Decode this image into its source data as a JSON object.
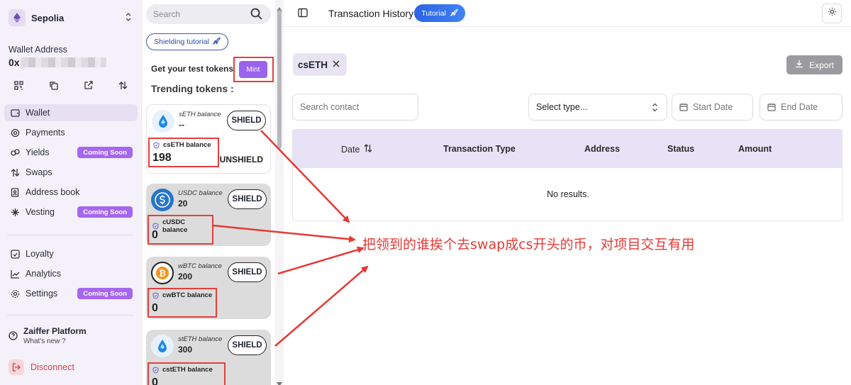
{
  "sidebar": {
    "network": "Sepolia",
    "wallet_label": "Wallet Address",
    "wallet_prefix": "0x",
    "nav_main": [
      {
        "label": "Wallet",
        "badge": ""
      },
      {
        "label": "Payments",
        "badge": ""
      },
      {
        "label": "Yields",
        "badge": "Coming Soon"
      },
      {
        "label": "Swaps",
        "badge": ""
      },
      {
        "label": "Address book",
        "badge": ""
      },
      {
        "label": "Vesting",
        "badge": "Coming Soon"
      }
    ],
    "nav_secondary": [
      {
        "label": "Loyalty",
        "badge": ""
      },
      {
        "label": "Analytics",
        "badge": ""
      },
      {
        "label": "Settings",
        "badge": "Coming Soon"
      }
    ],
    "platform_title": "Zaiffer Platform",
    "platform_sub": "What's new ?",
    "disconnect": "Disconnect"
  },
  "panel": {
    "search_placeholder": "Search",
    "shielding_tutorial": "Shielding tutorial",
    "get_tokens": "Get your test tokens",
    "mint": "Mint",
    "trending": "Trending tokens :",
    "shield_label": "SHIELD",
    "unshield_label": "UNSHIELD",
    "tokens": [
      {
        "label": "sETH balance",
        "value": "--",
        "c_label": "csETH balance",
        "c_value": "198"
      },
      {
        "label": "USDC balance",
        "value": "20",
        "c_label": "cUSDC balance",
        "c_value": "0"
      },
      {
        "label": "wBTC balance",
        "value": "200",
        "c_label": "cwBTC balance",
        "c_value": "0"
      },
      {
        "label": "stETH balance",
        "value": "300",
        "c_label": "cstETH balance",
        "c_value": "0"
      }
    ]
  },
  "main": {
    "title": "Transaction History",
    "tutorial": "Tutorial",
    "filter_chip": "csETH",
    "export": "Export",
    "search_contact": "Search contact",
    "select_type": "Select type...",
    "start_date": "Start Date",
    "end_date": "End Date",
    "columns": [
      "Date",
      "Transaction Type",
      "Address",
      "Status",
      "Amount"
    ],
    "empty": "No results."
  },
  "annotation": {
    "text": "把领到的谁挨个去swap成cs开头的币，对项目交互有用",
    "color": "#e53935"
  }
}
